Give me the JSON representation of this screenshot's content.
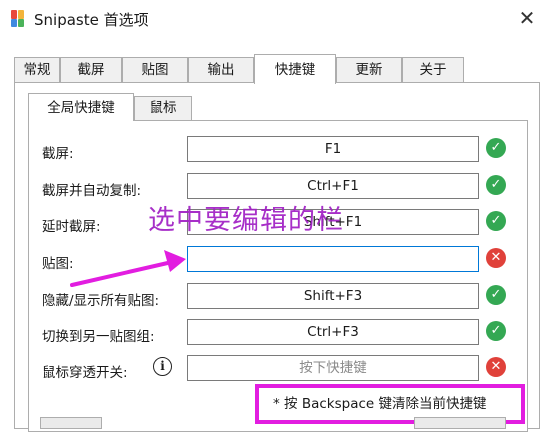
{
  "window": {
    "title": "Snipaste 首选项"
  },
  "tabs": [
    "常规",
    "截屏",
    "贴图",
    "输出",
    "快捷键",
    "更新",
    "关于"
  ],
  "sub_tabs": [
    "全局快捷键",
    "鼠标"
  ],
  "rows": [
    {
      "label": "截屏:",
      "value": "F1",
      "status": "ok"
    },
    {
      "label": "截屏并自动复制:",
      "value": "Ctrl+F1",
      "status": "ok"
    },
    {
      "label": "延时截屏:",
      "value": "Shift+F1",
      "status": "ok"
    },
    {
      "label": "贴图:",
      "value": "",
      "status": "error"
    },
    {
      "label": "隐藏/显示所有贴图:",
      "value": "Shift+F3",
      "status": "ok"
    },
    {
      "label": "切换到另一贴图组:",
      "value": "Ctrl+F3",
      "status": "ok"
    },
    {
      "label": "鼠标穿透开关:",
      "value": "",
      "placeholder": "按下快捷键",
      "status": "error"
    }
  ],
  "annotation": {
    "text": "选中要编辑的栏",
    "color": "#a01ec4"
  },
  "hint": {
    "text": "* 按 Backspace 键清除当前快捷键",
    "border_color": "#e21de0"
  },
  "colors": {
    "ok": "#34a853",
    "error": "#e0413a",
    "focus": "#0078d7",
    "arrow": "#e21de0"
  },
  "icons": {
    "info": "i",
    "ok": "check-icon",
    "error": "cross-icon",
    "close": "close-icon"
  }
}
